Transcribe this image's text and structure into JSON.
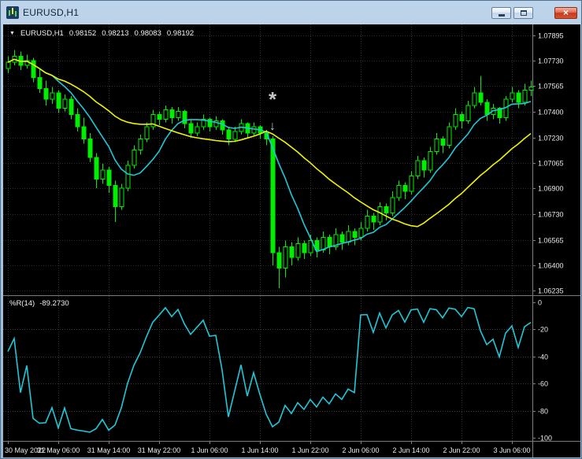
{
  "window": {
    "title": "EURUSD,H1",
    "controls": {
      "minimize_name": "minimize",
      "maximize_name": "maximize",
      "close_glyph": "×"
    }
  },
  "chart": {
    "header": {
      "dropdown_glyph": "▼",
      "symbol_period": "EURUSD,H1",
      "open": "0.98152",
      "high": "0.98213",
      "low": "0.98083",
      "close": "0.98192"
    }
  },
  "indicator": {
    "label": "%R(14)",
    "value": "-89.2730"
  },
  "chart_data": {
    "type": "candlestick",
    "symbol": "EURUSD",
    "timeframe": "H1",
    "ylim": [
      1.06235,
      1.07895
    ],
    "price_ticks": [
      1.07895,
      1.0773,
      1.07565,
      1.074,
      1.0723,
      1.07065,
      1.069,
      1.0673,
      1.06565,
      1.064,
      1.06235
    ],
    "price_labels": [
      "1.07895",
      "1.07730",
      "1.07565",
      "1.07400",
      "1.07230",
      "1.07065",
      "1.06900",
      "1.06730",
      "1.06565",
      "1.06400",
      "1.06235"
    ],
    "time_labels": [
      "30 May 2022",
      "31 May 06:00",
      "31 May 14:00",
      "31 May 22:00",
      "1 Jun 06:00",
      "1 Jun 14:00",
      "1 Jun 22:00",
      "2 Jun 06:00",
      "2 Jun 14:00",
      "2 Jun 22:00",
      "3 Jun 06:00"
    ],
    "bars_per_label": 8,
    "grid": true,
    "colors": {
      "background": "#000000",
      "grid": "#2e2e2e",
      "indicator_grid": "#3c3c3c",
      "axis_text": "#e8e8e8",
      "separator": "#808080",
      "candle": "#00ee00",
      "bull_fill": "#000000",
      "bear_fill": "#00ee00",
      "ma_fast": "#1fc8d8",
      "ma_slow": "#f2f200",
      "wpr_line": "#1fc8d8",
      "annotation": "#c4c4c4"
    },
    "candles": [
      [
        1.0768,
        1.0776,
        1.0765,
        1.0772
      ],
      [
        1.0772,
        1.078,
        1.077,
        1.0776
      ],
      [
        1.0776,
        1.0779,
        1.0767,
        1.077
      ],
      [
        1.077,
        1.0777,
        1.0768,
        1.0773
      ],
      [
        1.0773,
        1.0775,
        1.0759,
        1.0762
      ],
      [
        1.0762,
        1.0768,
        1.0752,
        1.0755
      ],
      [
        1.0755,
        1.076,
        1.0744,
        1.0748
      ],
      [
        1.0748,
        1.0756,
        1.0745,
        1.0752
      ],
      [
        1.0752,
        1.0754,
        1.0739,
        1.0742
      ],
      [
        1.0742,
        1.0751,
        1.074,
        1.0748
      ],
      [
        1.0748,
        1.075,
        1.0735,
        1.0738
      ],
      [
        1.0738,
        1.0742,
        1.0727,
        1.073
      ],
      [
        1.073,
        1.0736,
        1.0719,
        1.0722
      ],
      [
        1.0722,
        1.0726,
        1.0707,
        1.071
      ],
      [
        1.071,
        1.0713,
        1.069,
        1.0696
      ],
      [
        1.0696,
        1.0706,
        1.0693,
        1.0702
      ],
      [
        1.0702,
        1.0704,
        1.0687,
        1.0692
      ],
      [
        1.0692,
        1.0695,
        1.0668,
        1.0678
      ],
      [
        1.0678,
        1.0693,
        1.0676,
        1.069
      ],
      [
        1.069,
        1.0708,
        1.0688,
        1.0705
      ],
      [
        1.0705,
        1.0718,
        1.0703,
        1.0715
      ],
      [
        1.0715,
        1.0725,
        1.0712,
        1.0722
      ],
      [
        1.0722,
        1.0733,
        1.072,
        1.073
      ],
      [
        1.073,
        1.0741,
        1.0728,
        1.0738
      ],
      [
        1.0738,
        1.074,
        1.0731,
        1.0735
      ],
      [
        1.0735,
        1.0744,
        1.0733,
        1.0741
      ],
      [
        1.0741,
        1.0743,
        1.0732,
        1.0736
      ],
      [
        1.0736,
        1.0743,
        1.0734,
        1.074
      ],
      [
        1.074,
        1.0741,
        1.0729,
        1.0732
      ],
      [
        1.0732,
        1.0735,
        1.0723,
        1.0726
      ],
      [
        1.0726,
        1.0733,
        1.0724,
        1.073
      ],
      [
        1.073,
        1.0738,
        1.0728,
        1.0735
      ],
      [
        1.0735,
        1.0736,
        1.0727,
        1.073
      ],
      [
        1.073,
        1.0737,
        1.0728,
        1.0734
      ],
      [
        1.0734,
        1.0735,
        1.0725,
        1.0728
      ],
      [
        1.0728,
        1.073,
        1.0718,
        1.0722
      ],
      [
        1.0722,
        1.073,
        1.072,
        1.0727
      ],
      [
        1.0727,
        1.0735,
        1.0725,
        1.0732
      ],
      [
        1.0732,
        1.0733,
        1.0723,
        1.0726
      ],
      [
        1.0726,
        1.0733,
        1.0724,
        1.073
      ],
      [
        1.073,
        1.0731,
        1.0722,
        1.0726
      ],
      [
        1.0726,
        1.0728,
        1.0718,
        1.0722
      ],
      [
        1.0722,
        1.0724,
        1.064,
        1.0648
      ],
      [
        1.0648,
        1.0652,
        1.0625,
        1.0638
      ],
      [
        1.0638,
        1.0656,
        1.0632,
        1.0652
      ],
      [
        1.0652,
        1.0655,
        1.064,
        1.0645
      ],
      [
        1.0645,
        1.0658,
        1.0643,
        1.0654
      ],
      [
        1.0654,
        1.0656,
        1.0644,
        1.0648
      ],
      [
        1.0648,
        1.066,
        1.0646,
        1.0656
      ],
      [
        1.0656,
        1.0658,
        1.0645,
        1.065
      ],
      [
        1.065,
        1.0662,
        1.0648,
        1.0658
      ],
      [
        1.0658,
        1.066,
        1.0647,
        1.0652
      ],
      [
        1.0652,
        1.0664,
        1.065,
        1.066
      ],
      [
        1.066,
        1.0662,
        1.065,
        1.0655
      ],
      [
        1.0655,
        1.0666,
        1.0653,
        1.0662
      ],
      [
        1.0662,
        1.0664,
        1.0653,
        1.0658
      ],
      [
        1.0658,
        1.0668,
        1.0656,
        1.0664
      ],
      [
        1.0664,
        1.0676,
        1.0662,
        1.0672
      ],
      [
        1.0672,
        1.0674,
        1.0663,
        1.0668
      ],
      [
        1.0668,
        1.0681,
        1.0666,
        1.0678
      ],
      [
        1.0678,
        1.068,
        1.0669,
        1.0674
      ],
      [
        1.0674,
        1.0688,
        1.0672,
        1.0684
      ],
      [
        1.0684,
        1.0695,
        1.0682,
        1.0692
      ],
      [
        1.0692,
        1.0694,
        1.0683,
        1.0688
      ],
      [
        1.0688,
        1.0701,
        1.0686,
        1.0698
      ],
      [
        1.0698,
        1.0711,
        1.0696,
        1.0708
      ],
      [
        1.0708,
        1.071,
        1.0697,
        1.0702
      ],
      [
        1.0702,
        1.0717,
        1.07,
        1.0714
      ],
      [
        1.0714,
        1.0726,
        1.0712,
        1.0722
      ],
      [
        1.0722,
        1.0724,
        1.0713,
        1.0718
      ],
      [
        1.0718,
        1.0733,
        1.0716,
        1.073
      ],
      [
        1.073,
        1.0742,
        1.0728,
        1.0738
      ],
      [
        1.0738,
        1.074,
        1.0729,
        1.0734
      ],
      [
        1.0734,
        1.0747,
        1.0732,
        1.0744
      ],
      [
        1.0744,
        1.0756,
        1.0742,
        1.0752
      ],
      [
        1.0752,
        1.0763,
        1.0744,
        1.0746
      ],
      [
        1.0746,
        1.0748,
        1.0734,
        1.0738
      ],
      [
        1.0738,
        1.0745,
        1.0735,
        1.0742
      ],
      [
        1.0742,
        1.0743,
        1.0732,
        1.0736
      ],
      [
        1.0736,
        1.075,
        1.0734,
        1.0748
      ],
      [
        1.0748,
        1.0756,
        1.0746,
        1.0752
      ],
      [
        1.0752,
        1.0754,
        1.0742,
        1.0746
      ],
      [
        1.0746,
        1.0758,
        1.0744,
        1.0754
      ],
      [
        1.0754,
        1.076,
        1.075,
        1.0756
      ]
    ],
    "overlays": [
      {
        "name": "MA-fast",
        "method": "sma",
        "period": 8
      },
      {
        "name": "MA-slow",
        "method": "sma",
        "period": 24
      }
    ],
    "indicator": {
      "name": "%R",
      "period": 14,
      "current_value": -89.273,
      "range": [
        0,
        -100
      ],
      "scale_ticks": [
        0,
        -20,
        -40,
        -60,
        -80,
        -100
      ],
      "scale_labels": [
        "0",
        "-20",
        "-40",
        "-60",
        "-80",
        "-100"
      ],
      "grid_levels": [
        -20,
        -40,
        -60,
        -80
      ]
    },
    "annotations": [
      {
        "glyph": "*",
        "bar": 42,
        "price": 1.0748,
        "size": 26
      },
      {
        "glyph": "↓",
        "bar": 42,
        "price": 1.0731,
        "size": 16
      }
    ]
  }
}
